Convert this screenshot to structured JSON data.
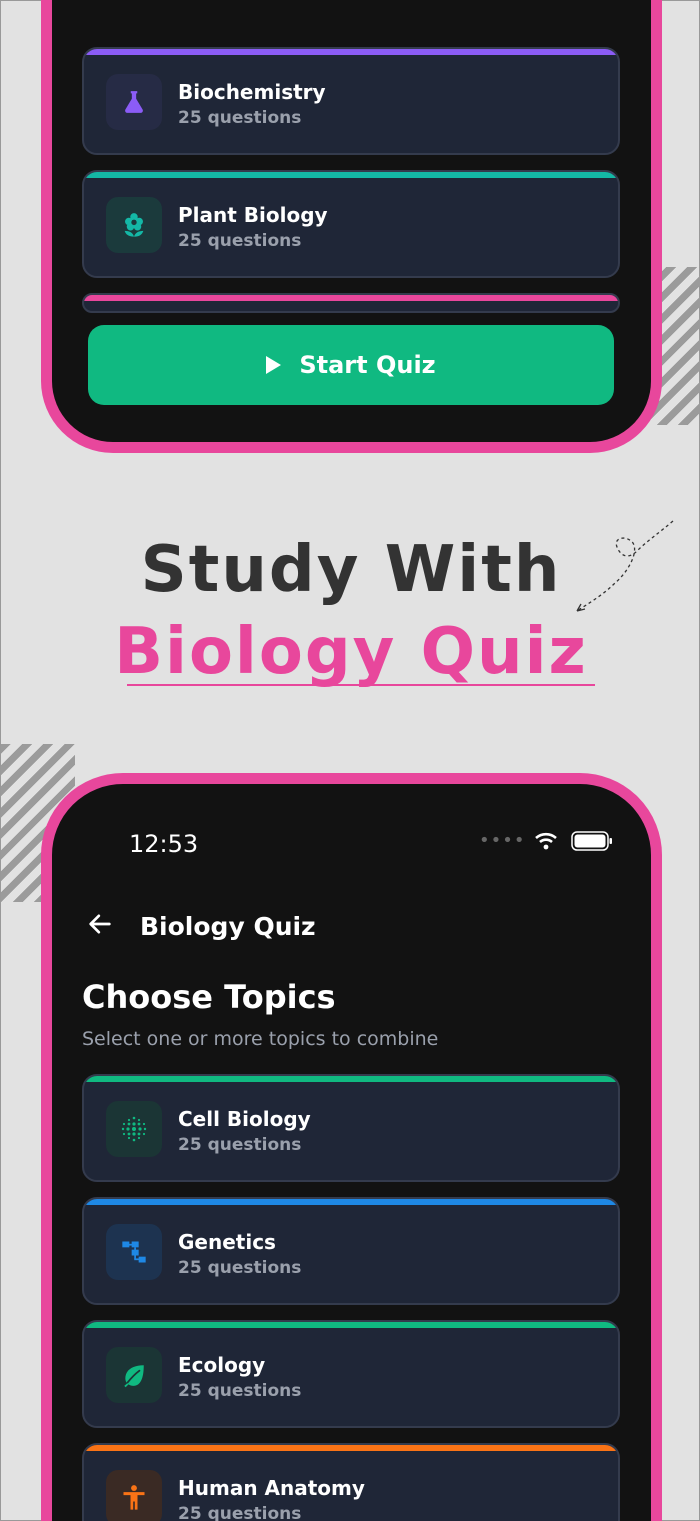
{
  "colors": {
    "accent": "#e8479c",
    "start_button": "#10b981",
    "card_bg": "#1f2637"
  },
  "top_screen": {
    "topics": [
      {
        "title": "Biochemistry",
        "subtitle": "25 questions",
        "bar_color": "#8b5cf6",
        "icon": "flask-icon"
      },
      {
        "title": "Plant Biology",
        "subtitle": "25 questions",
        "bar_color": "#14b8a6",
        "icon": "flower-icon"
      }
    ],
    "start_button_label": "Start Quiz"
  },
  "headline": {
    "line1": "Study With",
    "line2": "Biology Quiz"
  },
  "bottom_screen": {
    "status_time": "12:53",
    "header_title": "Biology Quiz",
    "page_title": "Choose Topics",
    "page_subtitle": "Select one or more topics to combine",
    "topics": [
      {
        "title": "Cell Biology",
        "subtitle": "25 questions",
        "bar_color": "#10b981",
        "icon": "cell-dots-icon"
      },
      {
        "title": "Genetics",
        "subtitle": "25 questions",
        "bar_color": "#1e88e5",
        "icon": "tree-structure-icon"
      },
      {
        "title": "Ecology",
        "subtitle": "25 questions",
        "bar_color": "#10b981",
        "icon": "leaf-icon"
      },
      {
        "title": "Human Anatomy",
        "subtitle": "25 questions",
        "bar_color": "#f97316",
        "icon": "person-icon"
      }
    ]
  }
}
